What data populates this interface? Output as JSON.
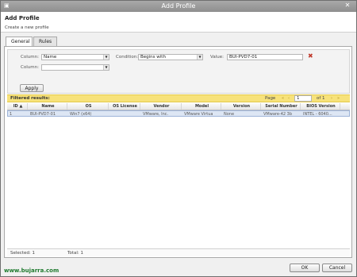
{
  "window": {
    "title": "Add Profile",
    "close_glyph": "✕",
    "icon": "window-app-icon"
  },
  "header": {
    "title": "Add Profile",
    "subtitle": "Create a new profile"
  },
  "tabs": [
    {
      "label": "General",
      "active": true
    },
    {
      "label": "Rules",
      "active": false
    }
  ],
  "filter": {
    "row1": {
      "column_label": "Column:",
      "column_value": "Name",
      "condition_label": "Condition:",
      "condition_value": "Begins with",
      "value_label": "Value:",
      "value_value": "BUI-PVD7-01"
    },
    "row2": {
      "column_label": "Column:",
      "column_value": ""
    },
    "apply_label": "Apply"
  },
  "results": {
    "label": "Filtered results:",
    "page_label": "Page",
    "page_value": "1",
    "of_label": "of 1"
  },
  "grid": {
    "columns": [
      "ID ▲",
      "Name",
      "OS",
      "OS License",
      "Vendor",
      "Model",
      "Version",
      "Serial Number",
      "BIOS Version"
    ],
    "rows": [
      [
        "1",
        "BUI-PVD7-01",
        "Win7 (x64)",
        "",
        "VMware, Inc.",
        "VMware Virtua",
        "None",
        "VMware-42 3b",
        "INTEL  - 6040..."
      ]
    ]
  },
  "status": {
    "selected": "Selected: 1",
    "total": "Total: 1"
  },
  "buttons": {
    "ok": "OK",
    "cancel": "Cancel"
  },
  "watermark": "www.bujarra.com",
  "colors": {
    "results_bar": "#f7e27a",
    "selected_row": "#dde6f4",
    "remove_icon": "#c0392b"
  }
}
